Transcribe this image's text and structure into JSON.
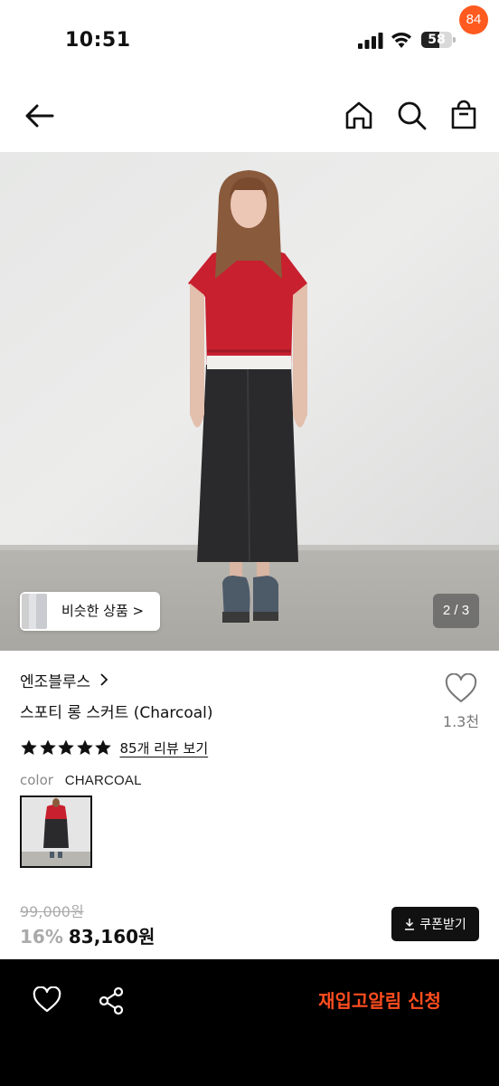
{
  "status_bar": {
    "time": "10:51",
    "battery_level": "58"
  },
  "header": {
    "cart_count": "84",
    "icons": [
      "back-arrow-icon",
      "home-icon",
      "search-icon",
      "shopping-bag-icon"
    ]
  },
  "gallery": {
    "similar_label": "비슷한 상품 >",
    "page_indicator": "2 / 3"
  },
  "product": {
    "brand": "엔조블루스",
    "name": "스포티 롱 스커트 (Charcoal)",
    "rating_stars": 5,
    "review_link": "85개 리뷰 보기",
    "like_count": "1.3천",
    "color_label": "color",
    "color_value": "CHARCOAL",
    "original_price": "99,000원",
    "discount": "16%",
    "sale_price": "83,160원",
    "coupon_label": "쿠폰받기"
  },
  "bottom_bar": {
    "restock_label": "재입고알림 신청"
  },
  "colors": {
    "accent": "#ff4d1f",
    "badge": "#ff5a1f",
    "shirt_red": "#c8202e",
    "skirt_charcoal": "#2a2a2c"
  }
}
